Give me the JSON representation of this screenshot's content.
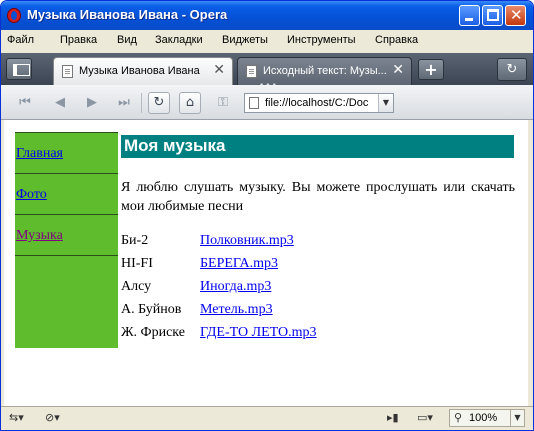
{
  "window": {
    "title": "Музыка Иванова Ивана - Opera"
  },
  "menu": {
    "items": [
      "Файл",
      "Правка",
      "Вид",
      "Закладки",
      "Виджеты",
      "Инструменты",
      "Справка"
    ]
  },
  "tabs": [
    {
      "label": "Музыка Иванова Ивана",
      "active": true
    },
    {
      "label": "Исходный текст: Музы...",
      "active": false
    }
  ],
  "address_bar": {
    "url": "file://localhost/C:/Doc"
  },
  "page": {
    "nav": [
      {
        "label": "Главная"
      },
      {
        "label": "Фото"
      },
      {
        "label": "Музыка"
      }
    ],
    "heading": "Моя музыка",
    "intro": "Я люблю слушать музыку. Вы можете прослушать или скачать мои любимые песни",
    "tracks": [
      {
        "artist": "Би-2",
        "file": "Полковник.mp3"
      },
      {
        "artist": "HI-FI",
        "file": "БЕРЕГА.mp3"
      },
      {
        "artist": "Алсу",
        "file": "Иногда.mp3"
      },
      {
        "artist": "А. Буйнов",
        "file": "Метель.mp3"
      },
      {
        "artist": "Ж. Фриске",
        "file": "ГДЕ-ТО ЛЕТО.mp3"
      }
    ]
  },
  "status_bar": {
    "zoom": "100%"
  },
  "colors": {
    "nav_background": "#5fbc2c",
    "heading_background": "#008080",
    "link": "#0000ee",
    "visited_link": "#800080"
  }
}
